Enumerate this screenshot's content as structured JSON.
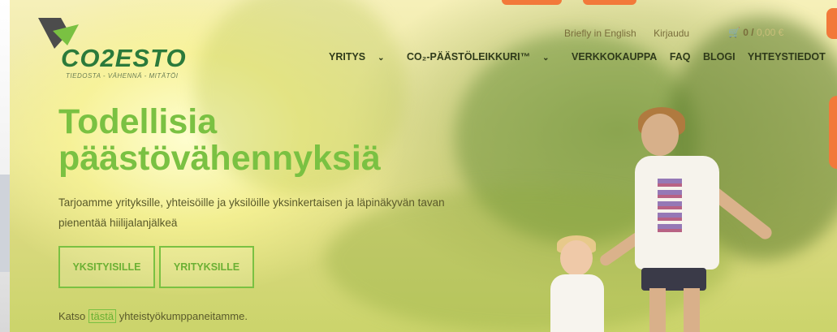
{
  "brand": {
    "logo_text": "CO2ESTO",
    "tagline": "TIEDOSTA - VÄHENNÄ - MITÄTÖI"
  },
  "top_links": {
    "english": "Briefly in English",
    "login": "Kirjaudu",
    "cart_count": "0 /",
    "cart_label": "0,00 €"
  },
  "nav": {
    "items": [
      {
        "label": "YRITYS",
        "dropdown": true
      },
      {
        "label": "CO₂-PÄÄSTÖLEIKKURI™",
        "dropdown": true
      },
      {
        "label": "VERKKOKAUPPA",
        "dropdown": false
      },
      {
        "label": "FAQ",
        "dropdown": false
      },
      {
        "label": "BLOGI",
        "dropdown": false
      },
      {
        "label": "YHTEYSTIEDOT",
        "dropdown": false
      }
    ]
  },
  "hero": {
    "headline_1": "Todellisia",
    "headline_2": "päästövähennyksiä",
    "subtext": "Tarjoamme yrityksille, yhteisöille ja yksilöille yksinkertaisen ja läpinäkyvän tavan pienentää hiilijalanjälkeä",
    "button_private": "YKSITYISILLE",
    "button_business": "YRITYKSILLE",
    "partners_prefix": "Katso",
    "partners_link": "tästä",
    "partners_suffix": "yhteistyökumppaneitamme."
  },
  "colors": {
    "accent_green": "#7ac142",
    "orange": "#f2793a"
  }
}
